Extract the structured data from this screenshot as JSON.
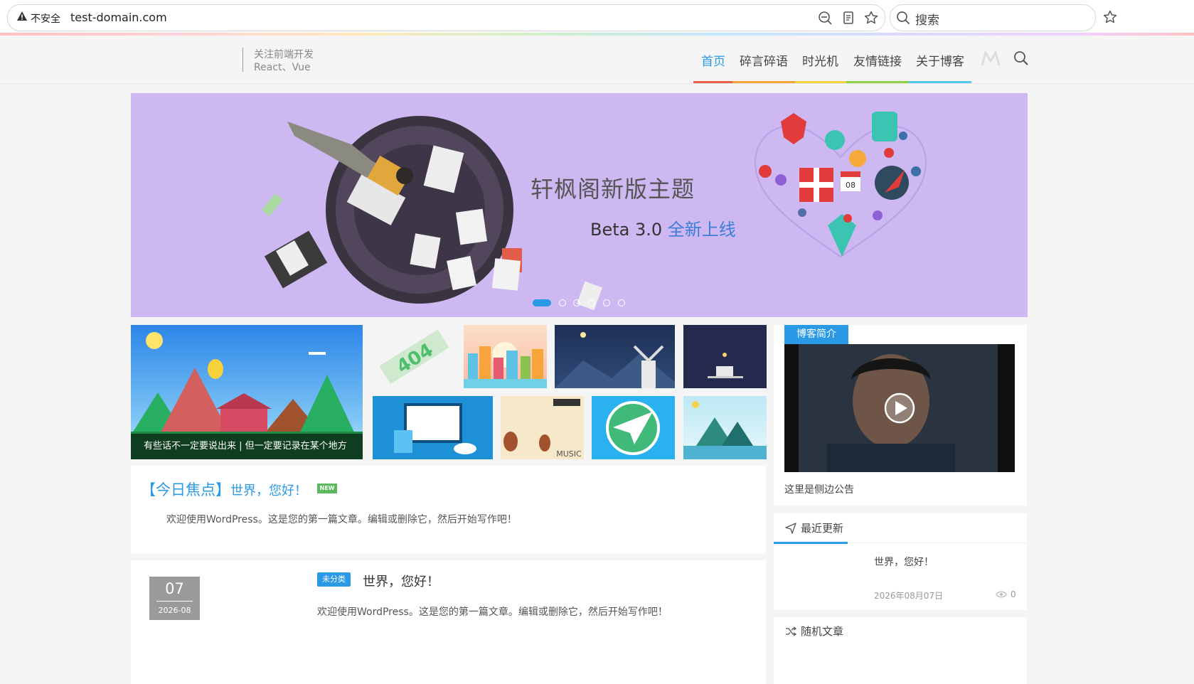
{
  "browser": {
    "security_label": "不安全",
    "url": "test-domain.com",
    "search_placeholder": "搜索"
  },
  "site": {
    "tagline_line1": "关注前端开发",
    "tagline_line2": "React、Vue",
    "nav": [
      {
        "label": "首页",
        "active": true
      },
      {
        "label": "碎言碎语",
        "active": false
      },
      {
        "label": "时光机",
        "active": false
      },
      {
        "label": "友情链接",
        "active": false
      },
      {
        "label": "关于博客",
        "active": false
      }
    ],
    "nav_underline_colors": [
      "#f0604a",
      "#f7a53a",
      "#f4d23a",
      "#8fd34a",
      "#54c7ee"
    ]
  },
  "banner": {
    "title": "轩枫阁新版主题",
    "subtitle_prefix": "Beta 3.0 ",
    "subtitle_highlight": "全新上线",
    "calendar_day": "08",
    "slide_count": 6,
    "active_slide": 1
  },
  "thumbnails": {
    "featured_caption": "有些话不一定要说出来 | 但一定要记录在某个地方",
    "tile_404_text": "404",
    "tile_music_text": "MUSIC"
  },
  "focus": {
    "bracket_label": "【今日焦点】",
    "title": "世界，您好！",
    "badge": "NEW",
    "excerpt": "欢迎使用WordPress。这是您的第一篇文章。编辑或删除它，然后开始写作吧！"
  },
  "post": {
    "day": "07",
    "year_month": "2026-08",
    "category": "未分类",
    "title": "世界，您好！",
    "excerpt": "欢迎使用WordPress。这是您的第一篇文章。编辑或删除它，然后开始写作吧！"
  },
  "sidebar": {
    "intro_tag": "博客简介",
    "notice": "这里是侧边公告",
    "recent_title": "最近更新",
    "recent_item_title": "世界，您好！",
    "recent_item_date": "2026年08月07日",
    "recent_item_views": "0",
    "random_title": "随机文章"
  },
  "colors": {
    "accent": "#2a9ae6",
    "banner_bg": "#cdb8f2",
    "new_badge": "#5cb85c"
  }
}
